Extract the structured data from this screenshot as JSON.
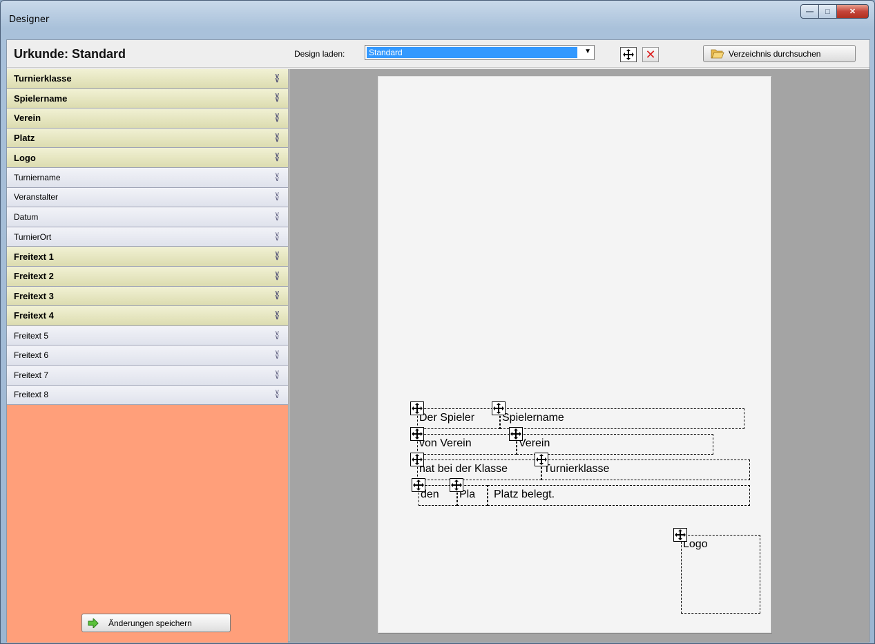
{
  "window": {
    "title": "Designer"
  },
  "header": {
    "title": "Urkunde: Standard",
    "design_label": "Design laden:",
    "design_value": "Standard",
    "browse_label": "Verzeichnis durchsuchen"
  },
  "sidebar": {
    "items": [
      {
        "label": "Turnierklasse",
        "style": "bold"
      },
      {
        "label": "Spielername",
        "style": "bold"
      },
      {
        "label": "Verein",
        "style": "bold"
      },
      {
        "label": "Platz",
        "style": "bold"
      },
      {
        "label": "Logo",
        "style": "bold"
      },
      {
        "label": "Turniername",
        "style": "plain"
      },
      {
        "label": "Veranstalter",
        "style": "plain"
      },
      {
        "label": "Datum",
        "style": "plain"
      },
      {
        "label": "TurnierOrt",
        "style": "plain"
      },
      {
        "label": "Freitext 1",
        "style": "bold"
      },
      {
        "label": "Freitext 2",
        "style": "bold"
      },
      {
        "label": "Freitext 3",
        "style": "bold"
      },
      {
        "label": "Freitext 4",
        "style": "bold"
      },
      {
        "label": "Freitext 5",
        "style": "plain"
      },
      {
        "label": "Freitext 6",
        "style": "plain"
      },
      {
        "label": "Freitext 7",
        "style": "plain"
      },
      {
        "label": "Freitext 8",
        "style": "plain"
      }
    ],
    "save_label": "Änderungen speichern"
  },
  "canvas": {
    "fields": {
      "der_spieler": "Der Spieler",
      "spielername": "Spielername",
      "von_verein": "von Verein",
      "verein": "Verein",
      "hat_bei_klasse": "hat bei der Klasse",
      "turnierklasse": "Turnierklasse",
      "den": "den",
      "pla": "Pla",
      "platz_belegt": "Platz belegt.",
      "logo": "Logo"
    }
  }
}
